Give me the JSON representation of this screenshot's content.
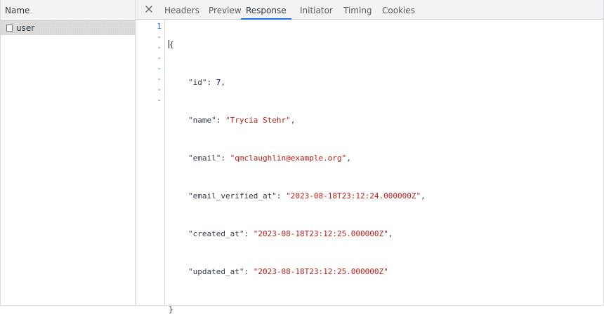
{
  "network": {
    "left_header": "Name",
    "requests": [
      {
        "name": "user",
        "selected": true
      }
    ]
  },
  "tabs": [
    {
      "label": "Headers",
      "active": false
    },
    {
      "label": "Preview",
      "active": false
    },
    {
      "label": "Response",
      "active": true
    },
    {
      "label": "Initiator",
      "active": false
    },
    {
      "label": "Timing",
      "active": false
    },
    {
      "label": "Cookies",
      "active": false
    }
  ],
  "icons": {
    "close": "close-icon",
    "request": "document-icon"
  },
  "colors": {
    "accent": "#1a73e8",
    "string": "#c41a16",
    "number": "#1c00cf",
    "text": "#303942"
  },
  "response": {
    "gutter": [
      "1",
      "-",
      "-",
      "-",
      "-",
      "-",
      "-",
      "-"
    ],
    "open_brace": "{",
    "close_brace": "}",
    "fields": [
      {
        "key": "\"id\"",
        "value": "7",
        "type": "number",
        "trail": ","
      },
      {
        "key": "\"name\"",
        "value": "\"Trycia Stehr\"",
        "type": "string",
        "trail": ","
      },
      {
        "key": "\"email\"",
        "value": "\"qmclaughlin@example.org\"",
        "type": "string",
        "trail": ","
      },
      {
        "key": "\"email_verified_at\"",
        "value": "\"2023-08-18T23:12:24.000000Z\"",
        "type": "string",
        "trail": ","
      },
      {
        "key": "\"created_at\"",
        "value": "\"2023-08-18T23:12:25.000000Z\"",
        "type": "string",
        "trail": ","
      },
      {
        "key": "\"updated_at\"",
        "value": "\"2023-08-18T23:12:25.000000Z\"",
        "type": "string",
        "trail": ""
      }
    ]
  }
}
